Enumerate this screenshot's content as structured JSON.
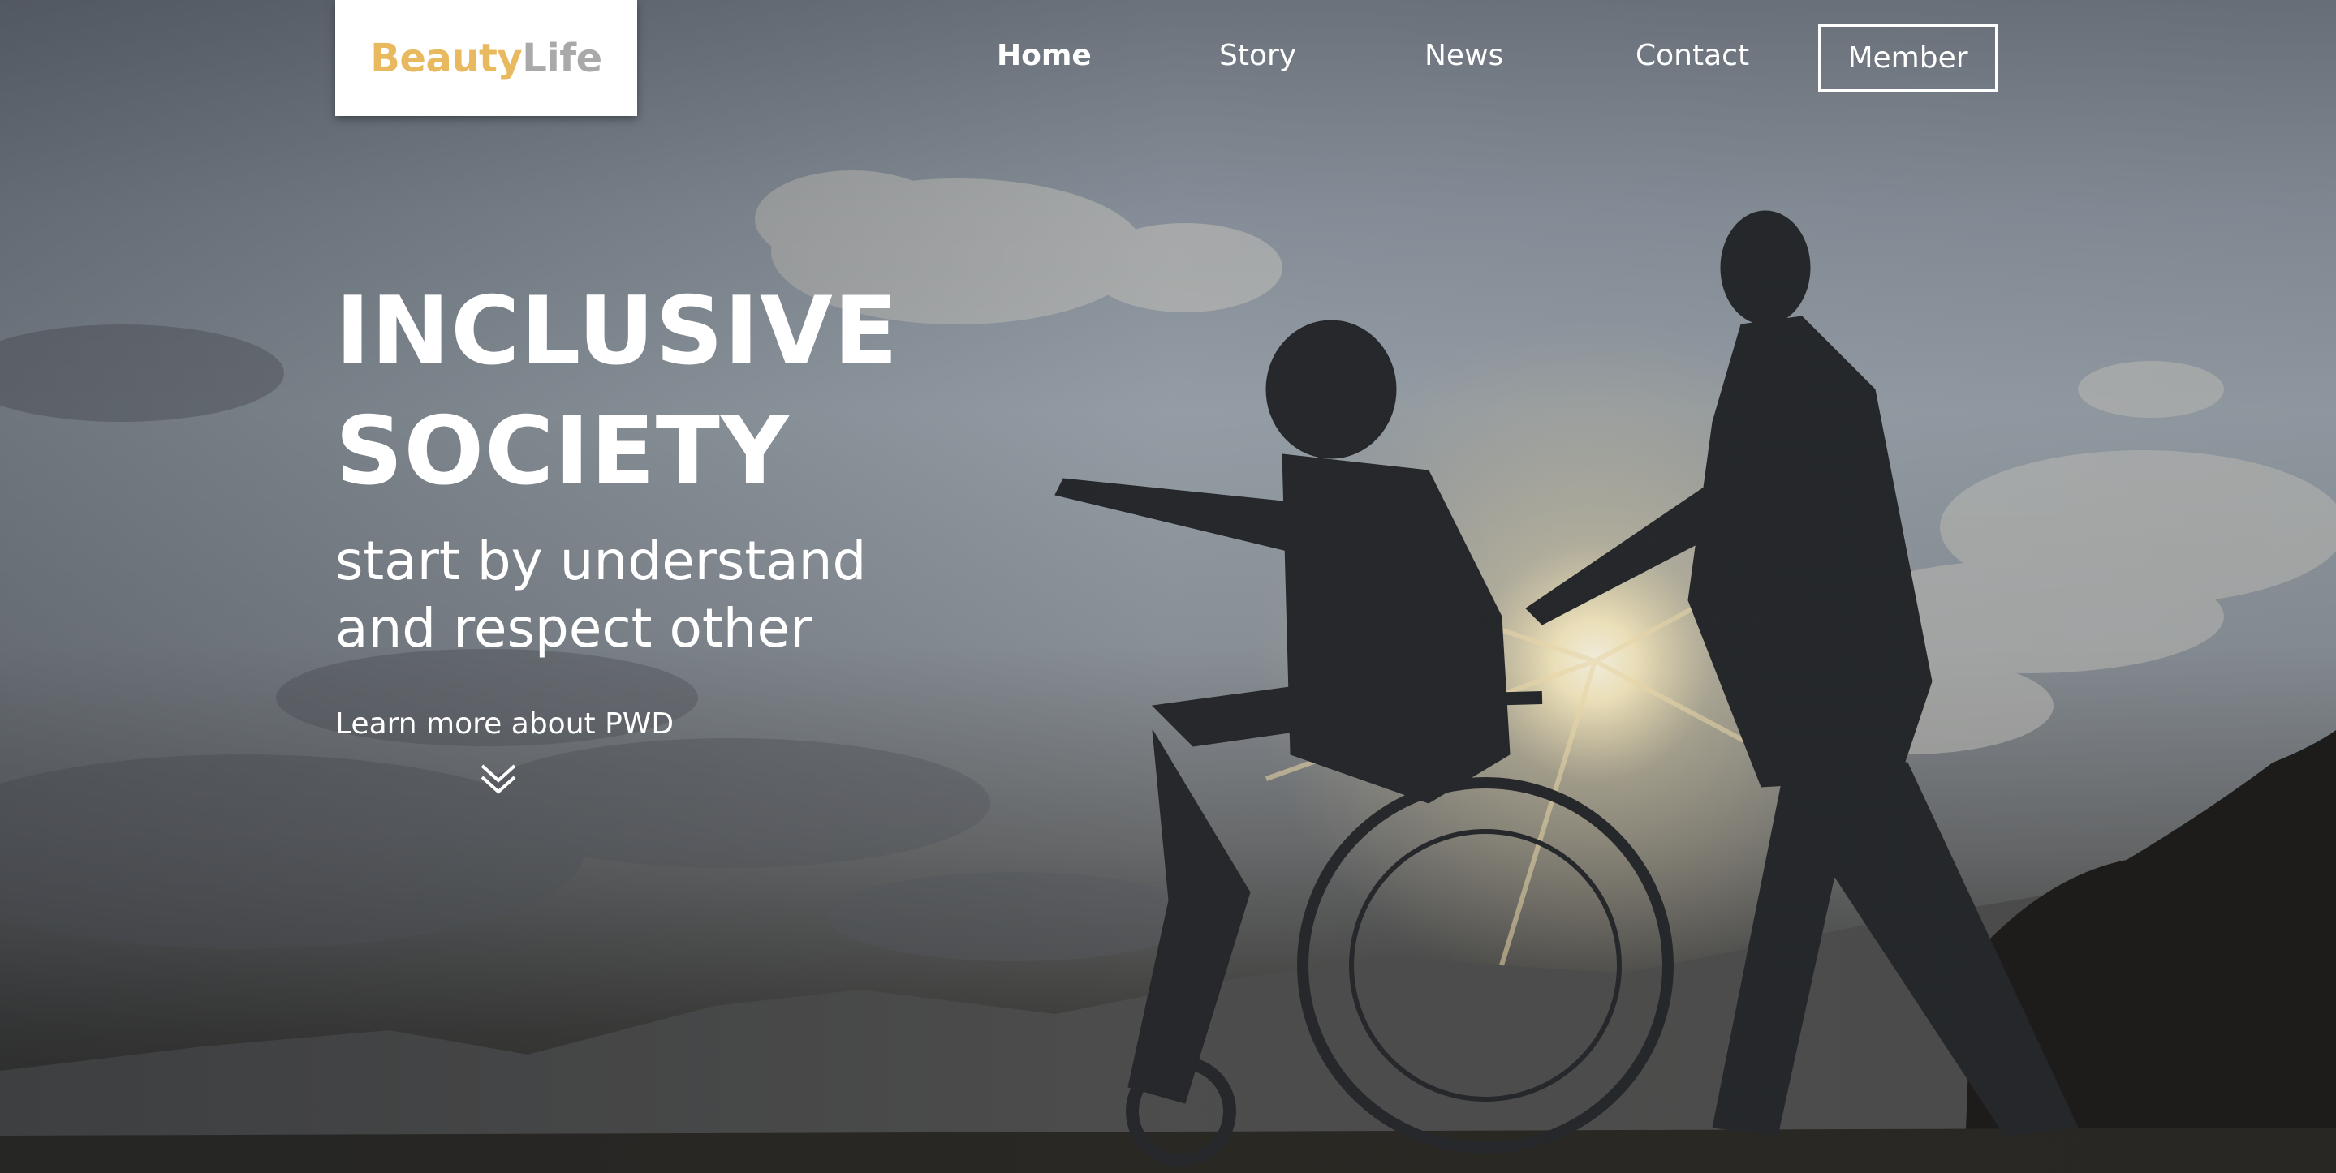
{
  "brand": {
    "part1": "Beauty",
    "part2": "Life"
  },
  "nav": {
    "home": "Home",
    "story": "Story",
    "news": "News",
    "contact": "Contact",
    "member": "Member"
  },
  "hero": {
    "headline_line1": "INCLUSIVE",
    "headline_line2": "SOCIETY",
    "sub_line1": "start by understand",
    "sub_line2": "and respect other",
    "learn_more": "Learn more about PWD"
  },
  "icons": {
    "scroll_down": "double-chevron-down-icon"
  },
  "colors": {
    "brand_accent": "#e8b95f",
    "brand_secondary": "#a9a9a9",
    "text": "#ffffff"
  }
}
